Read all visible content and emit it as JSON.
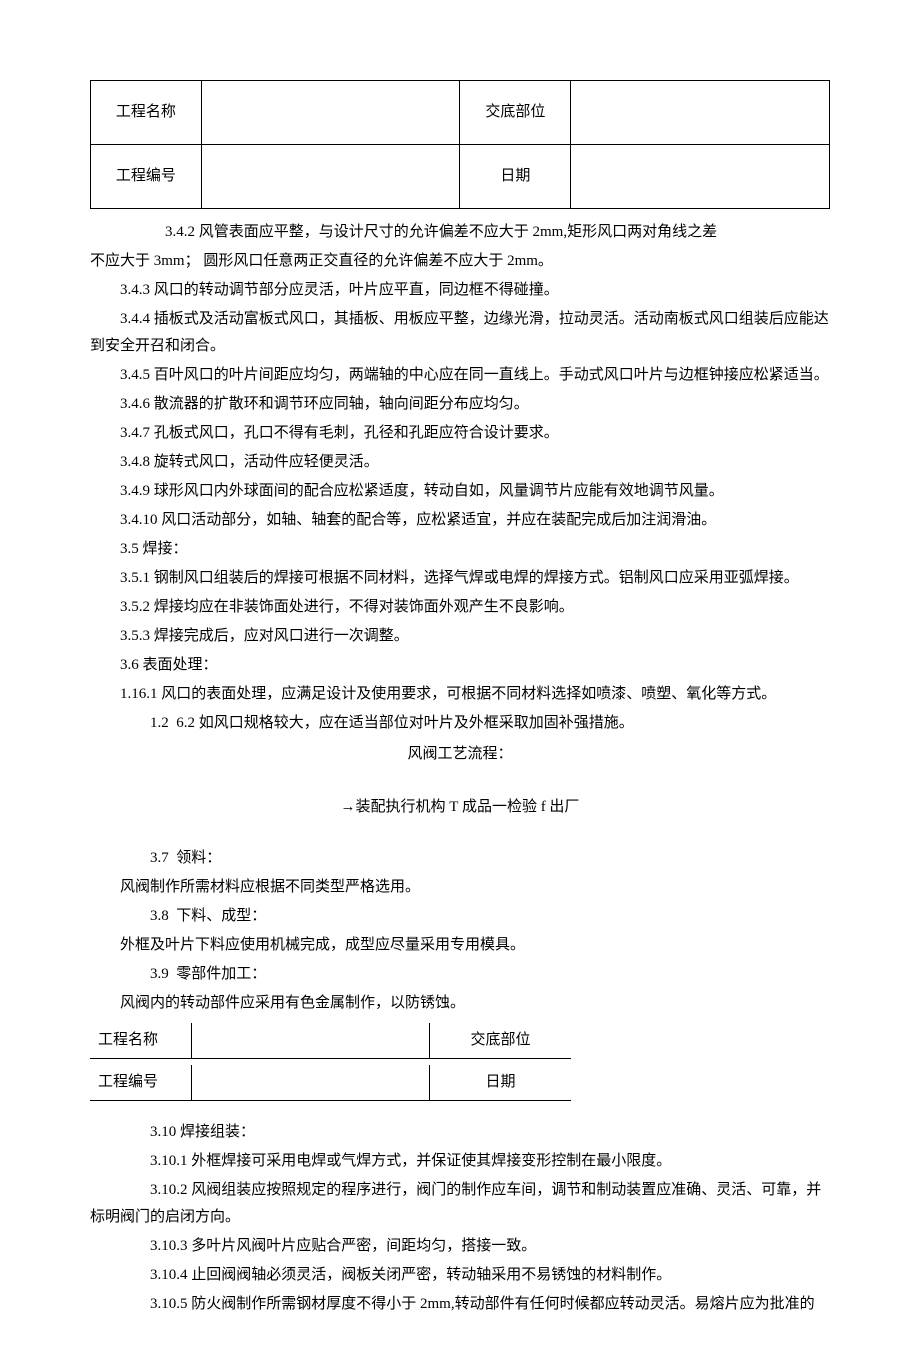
{
  "header_table": {
    "row1_label1": "工程名称",
    "row1_val1": "",
    "row1_label2": "交底部位",
    "row1_val2": "",
    "row2_label1": "工程编号",
    "row2_val1": "",
    "row2_label2": "日期",
    "row2_val2": ""
  },
  "paragraphs": {
    "p342a": "3.4.2 风管表面应平整，与设计尺寸的允许偏差不应大于 2mm,矩形风口两对角线之差",
    "p342b": "不应大于 3mm； 圆形风口任意两正交直径的允许偏差不应大于 2mm。",
    "p343": "3.4.3 风口的转动调节部分应灵活，叶片应平直，同边框不得碰撞。",
    "p344": "3.4.4 插板式及活动富板式风口，其插板、用板应平整，边缘光滑，拉动灵活。活动南板式风口组装后应能达到安全开召和闭合。",
    "p345": "3.4.5 百叶风口的叶片间距应均匀，两端轴的中心应在同一直线上。手动式风口叶片与边框钟接应松紧适当。",
    "p346": "3.4.6 散流器的扩散环和调节环应同轴，轴向间距分布应均匀。",
    "p347": "3.4.7 孔板式风口，孔口不得有毛刺，孔径和孔距应符合设计要求。",
    "p348": "3.4.8 旋转式风口，活动件应轻便灵活。",
    "p349": "3.4.9 球形风口内外球面间的配合应松紧适度，转动自如，风量调节片应能有效地调节风量。",
    "p3410": "3.4.10 风口活动部分，如轴、轴套的配合等，应松紧适宜，并应在装配完成后加注润滑油。",
    "p35": "3.5 焊接：",
    "p351": "3.5.1 钢制风口组装后的焊接可根据不同材料，选择气焊或电焊的焊接方式。铝制风口应采用亚弧焊接。",
    "p352": "3.5.2 焊接均应在非装饰面处进行，不得对装饰面外观产生不良影响。",
    "p353": "3.5.3 焊接完成后，应对风口进行一次调整。",
    "p36": "3.6 表面处理：",
    "p1161": "1.16.1 风口的表面处理，应满足设计及使用要求，可根据不同材料选择如喷漆、喷塑、氧化等方式。",
    "p12_num": "1.2",
    "p12_text": "6.2 如风口规格较大，应在适当部位对叶片及外框采取加固补强措施。",
    "flow_title": "风阀工艺流程：",
    "flow_line": "→装配执行机构 T 成品一检验 f 出厂",
    "p37_num": "3.7",
    "p37_text": "领料：",
    "p37_body": "风阀制作所需材料应根据不同类型严格选用。",
    "p38_num": "3.8",
    "p38_text": "下料、成型：",
    "p38_body": "外框及叶片下料应使用机械完成，成型应尽量采用专用模具。",
    "p39_num": "3.9",
    "p39_text": "零部件加工：",
    "p39_body": "风阀内的转动部件应采用有色金属制作，以防锈蚀。"
  },
  "inline_table": {
    "row1_label1": "工程名称",
    "row1_label2": "交底部位",
    "row2_label1": "工程编号",
    "row2_label2": "日期"
  },
  "paragraphs2": {
    "p310_num": "3.10",
    "p310_text": "焊接组装：",
    "p3101_num": "3.10.1",
    "p3101_text": "外框焊接可采用电焊或气焊方式，并保证使其焊接变形控制在最小限度。",
    "p3102_num": "3.10.2",
    "p3102_text": "风阀组装应按照规定的程序进行，阀门的制作应车间，调节和制动装置应准确、灵活、可靠，并标明阀门的启闭方向。",
    "p3103_num": "3.10.3",
    "p3103_text": "多叶片风阀叶片应贴合严密，间距均匀，搭接一致。",
    "p3104_num": "3.10.4",
    "p3104_text": "止回阀阀轴必须灵活，阀板关闭严密，转动轴采用不易锈蚀的材料制作。",
    "p3105_num": "3.10.5",
    "p3105_text": "防火阀制作所需钢材厚度不得小于 2mm,转动部件有任何时候都应转动灵活。易熔片应为批准的"
  }
}
